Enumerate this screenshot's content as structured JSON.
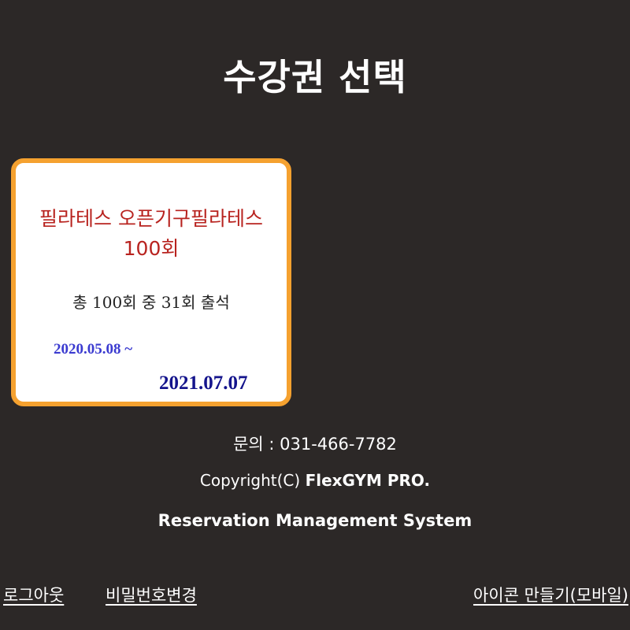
{
  "page": {
    "title": "수강권 선택"
  },
  "pass_card": {
    "name": "필라테스 오픈기구필라테스100회",
    "usage": "총 100회 중 31회 출석",
    "start_date": "2020.05.08 ~",
    "end_date": "2021.07.07",
    "colors": {
      "border": "#f5a12f",
      "name": "#b8231f",
      "start_date": "#3b3bd0",
      "end_date": "#14148c"
    }
  },
  "footer": {
    "contact": "문의 : 031-466-7782",
    "copyright_prefix": "Copyright(C) ",
    "copyright_brand": "FlexGYM PRO.",
    "system_name": "Reservation Management System"
  },
  "links": {
    "logout": "로그아웃",
    "change_password": "비밀번호변경",
    "make_icon": "아이콘 만들기(모바일)"
  },
  "theme": {
    "background": "#2c2827",
    "text": "#ffffff"
  }
}
